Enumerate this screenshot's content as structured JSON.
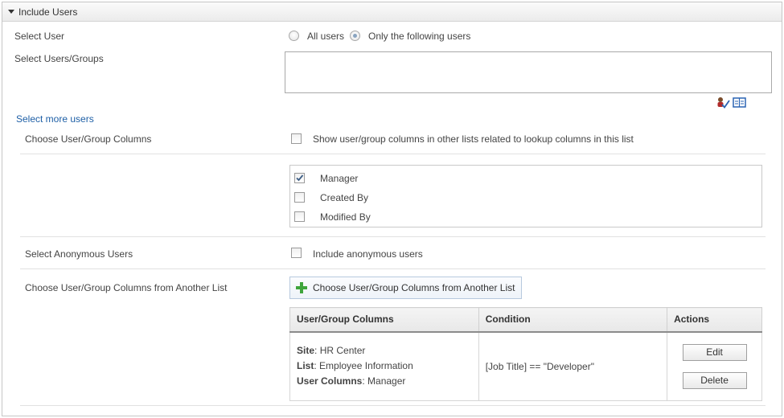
{
  "section": {
    "title": "Include Users"
  },
  "select_user": {
    "label": "Select User",
    "options": [
      {
        "label": "All users",
        "checked": false
      },
      {
        "label": "Only the following users",
        "checked": true
      }
    ]
  },
  "users_groups": {
    "label": "Select Users/Groups",
    "value": ""
  },
  "people_picker": {
    "check_icon": "check-names-icon",
    "browse_icon": "address-book-icon"
  },
  "select_more": {
    "label": "Select more users"
  },
  "columns": {
    "label": "Choose User/Group Columns",
    "show_related_label": "Show user/group columns in other lists related to lookup columns in this list",
    "show_related_checked": false,
    "items": [
      {
        "label": "Manager",
        "checked": true
      },
      {
        "label": "Created By",
        "checked": false
      },
      {
        "label": "Modified By",
        "checked": false
      }
    ]
  },
  "anonymous": {
    "label": "Select Anonymous Users",
    "checkbox_label": "Include anonymous users",
    "checked": false
  },
  "another_list": {
    "label": "Choose User/Group Columns from Another List",
    "button_label": "Choose User/Group Columns from Another List",
    "table": {
      "headers": [
        "User/Group Columns",
        "Condition",
        "Actions"
      ],
      "rows": [
        {
          "site_key": "Site",
          "site_value": "HR Center",
          "list_key": "List",
          "list_value": "Employee Information",
          "columns_key": "User Columns",
          "columns_value": "Manager",
          "condition": "[Job Title] == \"Developer\"",
          "edit_label": "Edit",
          "delete_label": "Delete"
        }
      ]
    }
  },
  "colors": {
    "link": "#1e5fa6",
    "add_icon": "#3fa53c",
    "border": "#c6c6c6"
  }
}
